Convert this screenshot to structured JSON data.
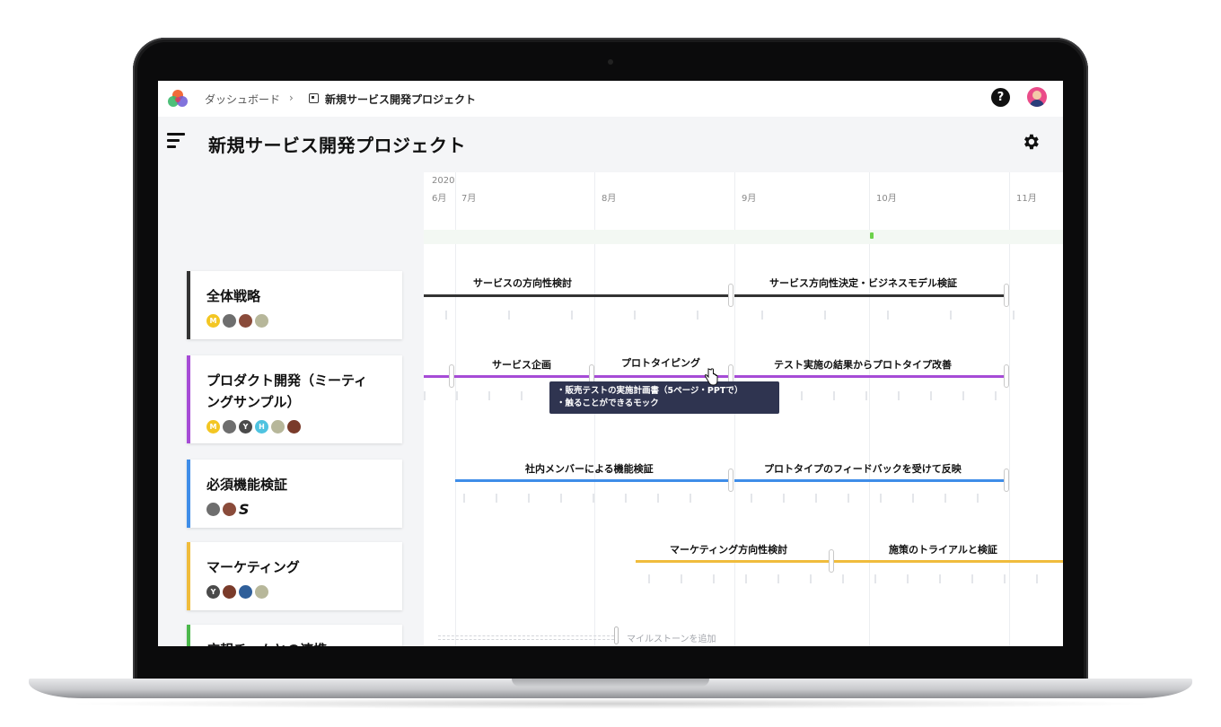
{
  "breadcrumb": {
    "dashboard": "ダッシュボード",
    "separator": "›",
    "project": "新規サービス開発プロジェクト"
  },
  "topbar": {
    "help_label": "?"
  },
  "header": {
    "title": "新規サービス開発プロジェクト"
  },
  "timeline": {
    "year": "2020",
    "months": [
      "6月",
      "7月",
      "8月",
      "9月",
      "10月",
      "11月"
    ],
    "add_milestone_label": "マイルストーンを追加"
  },
  "groups": [
    {
      "title": "全体戦略",
      "color": "#333333",
      "members": [
        "M",
        "",
        "",
        ""
      ],
      "milestones": [
        "サービスの方向性検討",
        "サービス方向性決定・ビジネスモデル検証"
      ]
    },
    {
      "title": "プロダクト開発（ミーティングサンプル）",
      "color": "#a64bd6",
      "members": [
        "M",
        "",
        "Y",
        "H",
        "",
        ""
      ],
      "milestones": [
        "サービス企画",
        "プロトタイピング",
        "テスト実施の結果からプロトタイプ改善"
      ]
    },
    {
      "title": "必須機能検証",
      "color": "#3f8de8",
      "members": [
        "",
        "",
        "S"
      ],
      "milestones": [
        "社内メンバーによる機能検証",
        "プロトタイプのフィードバックを受けて反映"
      ]
    },
    {
      "title": "マーケティング",
      "color": "#f0bc3c",
      "members": [
        "Y",
        "",
        "",
        ""
      ],
      "milestones": [
        "マーケティング方向性検討",
        "施策のトライアルと検証"
      ]
    },
    {
      "title": "広報チームとの連携",
      "color": "#4cb84c"
    }
  ],
  "tooltip": {
    "line1": "・販売テストの実施計画書（5ページ・PPTで）",
    "line2": "・触ることができるモック"
  }
}
